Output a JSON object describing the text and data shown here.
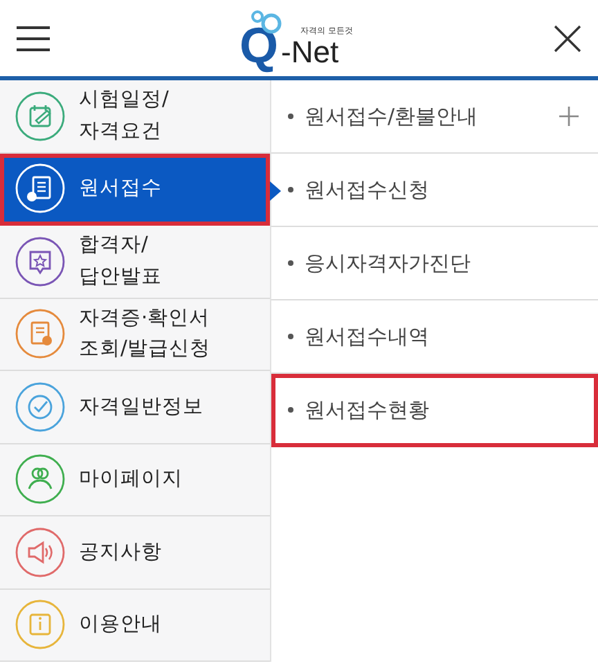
{
  "header": {
    "logo": {
      "tagline": "자격의 모든것",
      "letter": "Q",
      "name": "-Net"
    }
  },
  "menu": [
    {
      "label": "시험일정/\n자격요건",
      "kind": "calendar",
      "color": "#3bab7c",
      "selected": false,
      "highlighted": false
    },
    {
      "label": "원서접수",
      "kind": "document",
      "color": "#ffffff",
      "selected": true,
      "highlighted": true
    },
    {
      "label": "합격자/\n답안발표",
      "kind": "star",
      "color": "#7a55b5",
      "selected": false,
      "highlighted": false
    },
    {
      "label": "자격증·확인서\n조회/발급신청",
      "kind": "certificate",
      "color": "#e58a3c",
      "selected": false,
      "highlighted": false
    },
    {
      "label": "자격일반정보",
      "kind": "check",
      "color": "#4aa3dc",
      "selected": false,
      "highlighted": false
    },
    {
      "label": "마이페이지",
      "kind": "people",
      "color": "#3fae4f",
      "selected": false,
      "highlighted": false
    },
    {
      "label": "공지사항",
      "kind": "speaker",
      "color": "#e06a6a",
      "selected": false,
      "highlighted": false
    },
    {
      "label": "이용안내",
      "kind": "info",
      "color": "#e7b53b",
      "selected": false,
      "highlighted": false
    }
  ],
  "submenu": [
    {
      "label": "원서접수/환불안내",
      "expandable": true,
      "highlighted": false
    },
    {
      "label": "원서접수신청",
      "expandable": false,
      "highlighted": false
    },
    {
      "label": "응시자격자가진단",
      "expandable": false,
      "highlighted": false
    },
    {
      "label": "원서접수내역",
      "expandable": false,
      "highlighted": false
    },
    {
      "label": "원서접수현황",
      "expandable": false,
      "highlighted": true
    }
  ]
}
